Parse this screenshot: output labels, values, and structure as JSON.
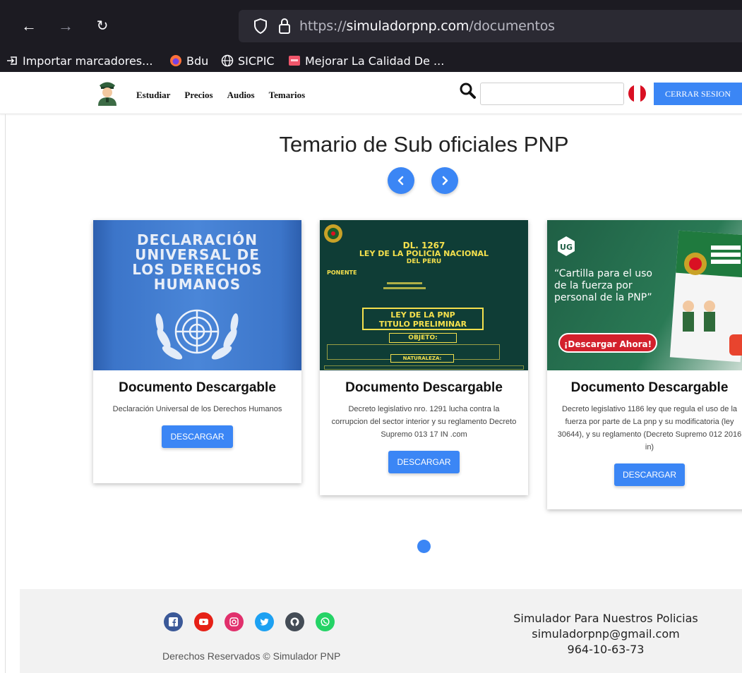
{
  "browser": {
    "url_scheme": "https://",
    "url_host": "simuladorpnp.com",
    "url_path": "/documentos",
    "bookmarks": [
      "Importar marcadores...",
      "Bdu",
      "SICPIC",
      "Mejorar La Calidad De ..."
    ]
  },
  "nav": {
    "links": [
      "Estudiar",
      "Precios",
      "Audios",
      "Temarios"
    ],
    "search_value": "",
    "logout_label": "CERRAR SESION"
  },
  "page": {
    "title": "Temario de Sub oficiales PNP"
  },
  "cards": [
    {
      "img_lines": [
        "DECLARACIÓN",
        "UNIVERSAL DE",
        "LOS DERECHOS",
        "HUMANOS"
      ],
      "title": "Documento Descargable",
      "desc": "Declaración Universal de los Derechos Humanos",
      "button": "DESCARGAR"
    },
    {
      "img_lines": [
        "DL. 1267",
        "LEY DE LA POLICIA NACIONAL",
        "DEL PERU",
        "PONENTE",
        "LEY DE LA PNP",
        "TITULO PRELIMINAR",
        "OBJETO:",
        "NATURALEZA:"
      ],
      "title": "Documento Descargable",
      "desc": "Decreto legislativo nro. 1291 lucha contra la corrupcion del sector interior y su reglamento Decreto Supremo 013 17 IN .com",
      "button": "DESCARGAR"
    },
    {
      "img_lines": [
        "“Cartilla para el uso",
        "de la fuerza por",
        "personal de la PNP”",
        "¡Descargar Ahora!"
      ],
      "title": "Documento Descargable",
      "desc": "Decreto legislativo 1186 ley que regula el uso de la fuerza por parte de La pnp y su modificatoria (ley 30644), y su reglamento (Decreto Supremo 012 2016 in)",
      "button": "DESCARGAR"
    }
  ],
  "footer": {
    "rights": "Derechos Reservados © Simulador PNP",
    "contact_name": "Simulador Para Nuestros Policias",
    "contact_email": "simuladorpnp@gmail.com",
    "contact_phone": "964-10-63-73",
    "social_icons": [
      "facebook-icon",
      "youtube-icon",
      "instagram-icon",
      "twitter-icon",
      "github-icon",
      "whatsapp-icon"
    ],
    "social_colors": [
      "#3b5998",
      "#e62117",
      "#e1306c",
      "#1da1f2",
      "#444c56",
      "#25d366"
    ]
  },
  "colors": {
    "accent": "#3b86f5"
  }
}
